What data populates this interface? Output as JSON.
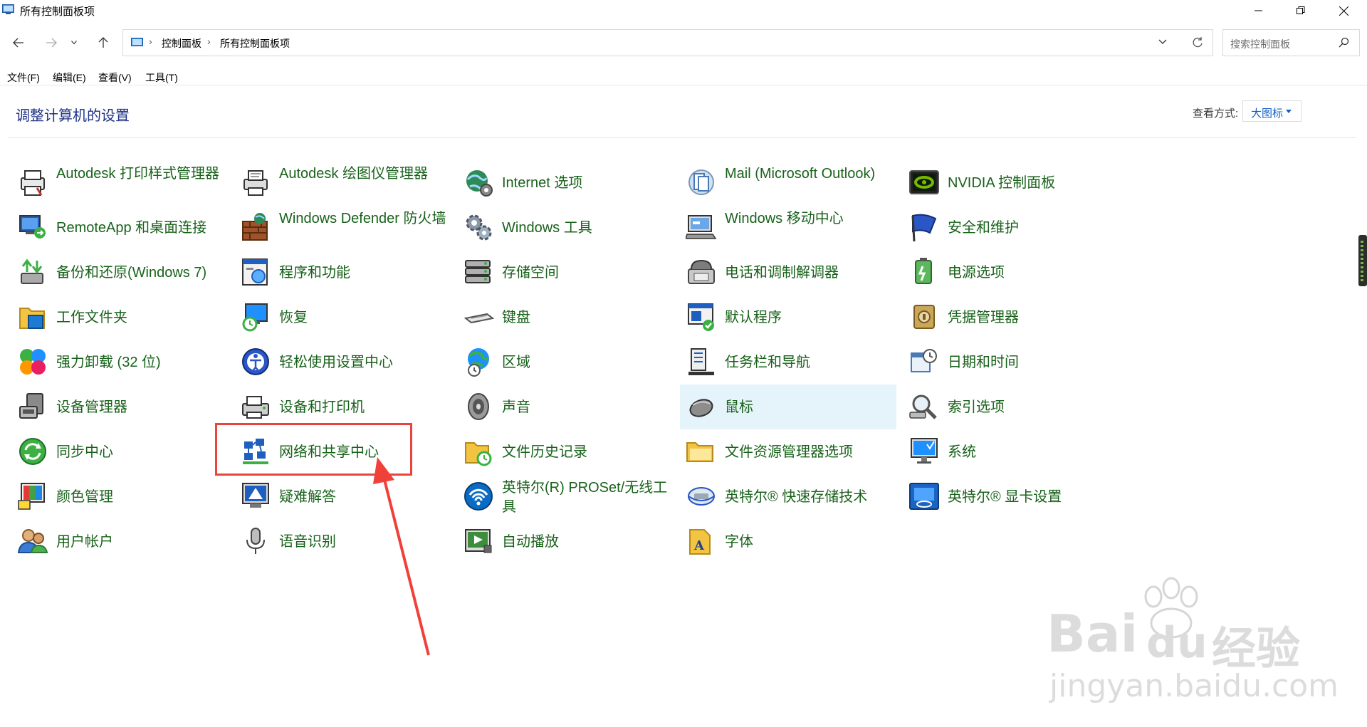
{
  "window": {
    "title": "所有控制面板项"
  },
  "address": {
    "crumbs": [
      "控制面板",
      "所有控制面板项"
    ]
  },
  "search": {
    "placeholder": "搜索控制面板"
  },
  "menu": [
    "文件(F)",
    "编辑(E)",
    "查看(V)",
    "工具(T)"
  ],
  "content": {
    "title": "调整计算机的设置",
    "view_by_label": "查看方式:",
    "view_by_value": "大图标"
  },
  "items": [
    {
      "label": "Autodesk 打印样式管理器",
      "icon": "printer-style-icon"
    },
    {
      "label": "Autodesk 绘图仪管理器",
      "icon": "plotter-icon"
    },
    {
      "label": "Internet 选项",
      "icon": "globe-settings-icon"
    },
    {
      "label": "Mail (Microsoft Outlook)",
      "icon": "mail-icon"
    },
    {
      "label": "NVIDIA 控制面板",
      "icon": "nvidia-icon"
    },
    {
      "label": "RemoteApp 和桌面连接",
      "icon": "remote-desktop-icon"
    },
    {
      "label": "Windows Defender 防火墙",
      "icon": "firewall-icon"
    },
    {
      "label": "Windows 工具",
      "icon": "gears-icon"
    },
    {
      "label": "Windows 移动中心",
      "icon": "mobility-center-icon"
    },
    {
      "label": "安全和维护",
      "icon": "security-flag-icon"
    },
    {
      "label": "备份和还原(Windows 7)",
      "icon": "backup-icon"
    },
    {
      "label": "程序和功能",
      "icon": "programs-icon"
    },
    {
      "label": "存储空间",
      "icon": "storage-icon"
    },
    {
      "label": "电话和调制解调器",
      "icon": "phone-modem-icon"
    },
    {
      "label": "电源选项",
      "icon": "power-icon"
    },
    {
      "label": "工作文件夹",
      "icon": "work-folders-icon"
    },
    {
      "label": "恢复",
      "icon": "recovery-icon"
    },
    {
      "label": "键盘",
      "icon": "keyboard-icon"
    },
    {
      "label": "默认程序",
      "icon": "default-programs-icon"
    },
    {
      "label": "凭据管理器",
      "icon": "credential-vault-icon"
    },
    {
      "label": "强力卸载 (32 位)",
      "icon": "uninstaller-icon"
    },
    {
      "label": "轻松使用设置中心",
      "icon": "ease-of-access-icon"
    },
    {
      "label": "区域",
      "icon": "region-globe-icon"
    },
    {
      "label": "任务栏和导航",
      "icon": "taskbar-icon"
    },
    {
      "label": "日期和时间",
      "icon": "calendar-clock-icon"
    },
    {
      "label": "设备管理器",
      "icon": "device-manager-icon"
    },
    {
      "label": "设备和打印机",
      "icon": "devices-printers-icon"
    },
    {
      "label": "声音",
      "icon": "speaker-icon"
    },
    {
      "label": "鼠标",
      "icon": "mouse-icon"
    },
    {
      "label": "索引选项",
      "icon": "indexing-icon"
    },
    {
      "label": "同步中心",
      "icon": "sync-icon"
    },
    {
      "label": "网络和共享中心",
      "icon": "network-icon"
    },
    {
      "label": "文件历史记录",
      "icon": "file-history-icon"
    },
    {
      "label": "文件资源管理器选项",
      "icon": "folder-options-icon"
    },
    {
      "label": "系统",
      "icon": "system-monitor-icon"
    },
    {
      "label": "颜色管理",
      "icon": "color-management-icon"
    },
    {
      "label": "疑难解答",
      "icon": "troubleshoot-icon"
    },
    {
      "label": "英特尔(R) PROSet/无线工具",
      "icon": "wireless-icon"
    },
    {
      "label": "英特尔® 快速存储技术",
      "icon": "rapid-storage-icon"
    },
    {
      "label": "英特尔® 显卡设置",
      "icon": "intel-graphics-icon"
    },
    {
      "label": "用户帐户",
      "icon": "user-accounts-icon"
    },
    {
      "label": "语音识别",
      "icon": "microphone-icon"
    },
    {
      "label": "自动播放",
      "icon": "autoplay-icon"
    },
    {
      "label": "字体",
      "icon": "fonts-icon"
    }
  ],
  "watermark": {
    "brand": "Bai",
    "brand2": "du",
    "site": "jingyan.baidu.com",
    "cn": "经验"
  }
}
